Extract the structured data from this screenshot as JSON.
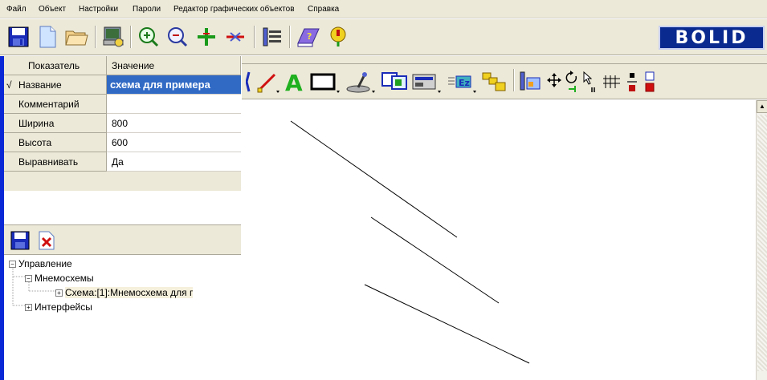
{
  "menu": {
    "items": [
      "Файл",
      "Объект",
      "Настройки",
      "Пароли",
      "Редактор графических объектов",
      "Справка"
    ]
  },
  "toolbar": {
    "buttons": [
      "save-icon",
      "new-icon",
      "open-icon",
      "config-icon",
      "zoom-in-icon",
      "zoom-out-icon",
      "add-plus-icon",
      "remove-icon",
      "settings-tools-icon",
      "book-icon",
      "info-icon"
    ]
  },
  "brand": {
    "logo_text": "BOLID"
  },
  "properties": {
    "header_name": "Показатель",
    "header_value": "Значение",
    "rows": [
      {
        "name": "Название",
        "value": "схема для примера",
        "checked": "√"
      },
      {
        "name": "Комментарий",
        "value": ""
      },
      {
        "name": "Ширина",
        "value": "800"
      },
      {
        "name": "Высота",
        "value": "600"
      },
      {
        "name": "Выравнивать",
        "value": "Да"
      }
    ]
  },
  "tree": {
    "nodes": [
      {
        "label": "Управление",
        "toggle": "−"
      },
      {
        "label": "Мнемосхемы",
        "toggle": "−"
      },
      {
        "label": "Схема:[1]:Мнемосхема для г",
        "toggle": "+"
      },
      {
        "label": "Интерфейсы",
        "toggle": "+"
      }
    ]
  },
  "editor": {
    "tools": [
      "line-tool-icon",
      "text-tool-icon",
      "rectangle-tool-icon",
      "joystick-icon",
      "image-icon",
      "device-icon",
      "label-edit-icon",
      "group-icon",
      "object-properties-icon",
      "move-icon",
      "rotate-icon",
      "pointer-icon",
      "grid-icon",
      "align-icon",
      "color-icon"
    ]
  },
  "colors": {
    "chrome": "#ece9d8",
    "selection": "#316ac5",
    "panel_border": "#0a28d6",
    "brand_bg": "#0a2a8f"
  }
}
